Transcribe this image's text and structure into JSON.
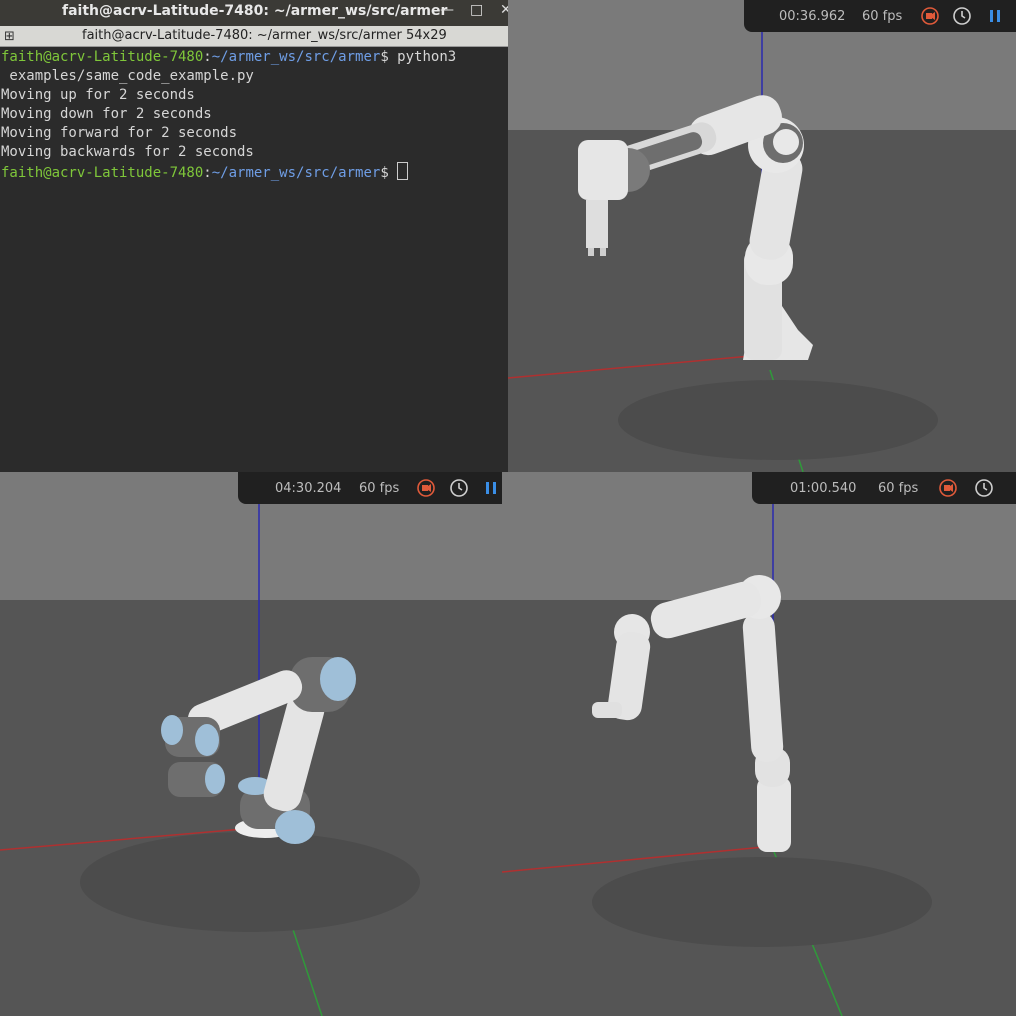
{
  "terminal": {
    "window_title": "faith@acrv-Latitude-7480: ~/armer_ws/src/armer",
    "minimize_label": "—",
    "maximize_label": "□",
    "tab_title": "faith@acrv-Latitude-7480: ~/armer_ws/src/armer 54x29",
    "prompt_user": "faith@acrv-Latitude-7480",
    "prompt_path": "~/armer_ws/src/armer",
    "prompt_symbol": "$",
    "command_line1": " python3",
    "command_line2": " examples/same_code_example.py",
    "output": [
      "Moving up for 2 seconds",
      "Moving down for 2 seconds",
      "Moving forward for 2 seconds",
      "Moving backwards for 2 seconds"
    ]
  },
  "sims": [
    {
      "time": "00:36.962",
      "fps": "60 fps"
    },
    {
      "time": "04:30.204",
      "fps": "60 fps"
    },
    {
      "time": "01:00.540",
      "fps": "60 fps"
    }
  ],
  "colors": {
    "terminal_bg": "#2b2b2b",
    "prompt_user": "#7fc73a",
    "prompt_path": "#6f9ee6",
    "record_icon": "#e05a3a",
    "pause_icon": "#3a8ee6",
    "hud_bg": "#202020",
    "sky": "#7a7a7a",
    "floor": "#555555",
    "robot_white": "#e6e6e6",
    "robot_gray": "#6e6e6e",
    "ur_blue": "#9fbfd8",
    "axis_x": "#b03030",
    "axis_y": "#2f9a3a",
    "axis_z": "#2a2ab0"
  },
  "icons": [
    "terminal-menu-icon",
    "record-icon",
    "clock-icon",
    "pause-icon"
  ]
}
